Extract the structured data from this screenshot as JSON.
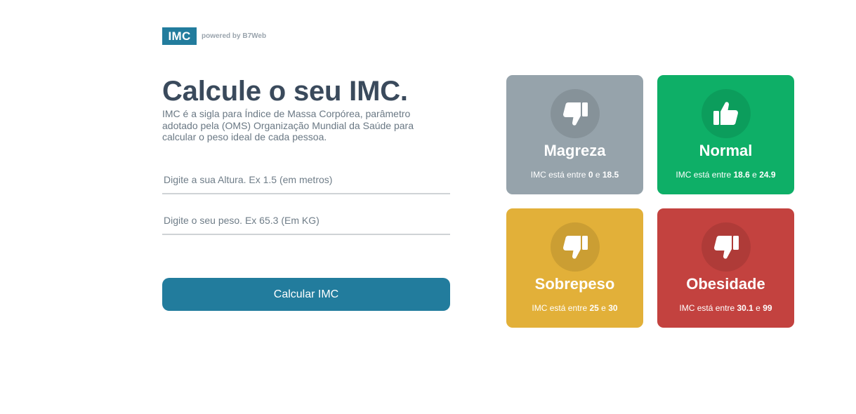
{
  "header": {
    "logo_text": "IMC",
    "powered_by": "powered by B7Web"
  },
  "main": {
    "title": "Calcule o seu IMC.",
    "description": "IMC é a sigla para Índice de Massa Corpórea, parâmetro adotado pela (OMS) Organização Mundial da Saúde para calcular o peso ideal de cada pessoa.",
    "altura_placeholder": "Digite a sua Altura. Ex 1.5 (em metros)",
    "peso_placeholder": "Digite o seu peso. Ex 65.3 (Em KG)",
    "button_label": "Calcular IMC"
  },
  "cards": [
    {
      "name": "Magreza",
      "range_prefix": "IMC está entre",
      "min": "0",
      "joiner": "e",
      "max": "18.5",
      "icon": "thumbs-down-icon",
      "color": "#96a3ab"
    },
    {
      "name": "Normal",
      "range_prefix": "IMC está entre",
      "min": "18.6",
      "joiner": "e",
      "max": "24.9",
      "icon": "thumbs-up-icon",
      "color": "#0eaf67"
    },
    {
      "name": "Sobrepeso",
      "range_prefix": "IMC está entre",
      "min": "25",
      "joiner": "e",
      "max": "30",
      "icon": "thumbs-down-icon",
      "color": "#e2b039"
    },
    {
      "name": "Obesidade",
      "range_prefix": "IMC está entre",
      "min": "30.1",
      "joiner": "e",
      "max": "99",
      "icon": "thumbs-down-icon",
      "color": "#c3423f"
    }
  ]
}
